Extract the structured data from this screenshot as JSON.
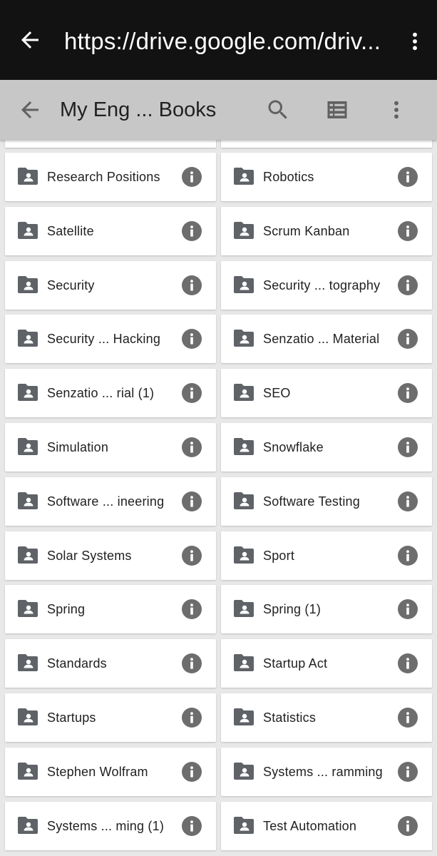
{
  "browser": {
    "url": "https://drive.google.com/driv..."
  },
  "appbar": {
    "title": "My Eng ... Books"
  },
  "folders": [
    [
      "Research Positions",
      "Robotics"
    ],
    [
      "Satellite",
      "Scrum Kanban"
    ],
    [
      "Security",
      "Security ... tography"
    ],
    [
      "Security ... Hacking",
      "Senzatio ... Material"
    ],
    [
      "Senzatio ... rial (1)",
      "SEO"
    ],
    [
      "Simulation",
      "Snowflake"
    ],
    [
      "Software ... ineering",
      "Software Testing"
    ],
    [
      "Solar Systems",
      "Sport"
    ],
    [
      "Spring",
      "Spring (1)"
    ],
    [
      "Standards",
      "Startup Act"
    ],
    [
      "Startups",
      "Statistics"
    ],
    [
      "Stephen Wolfram",
      "Systems ... ramming"
    ],
    [
      "Systems ... ming (1)",
      "Test Automation"
    ]
  ],
  "colors": {
    "status_bar": "#121212",
    "app_bar": "#c7c7c7",
    "background": "#e8e8e8",
    "card": "#ffffff",
    "icon": "#5f6368"
  },
  "icons": {
    "folder": "shared-folder-icon",
    "info": "info-icon"
  }
}
